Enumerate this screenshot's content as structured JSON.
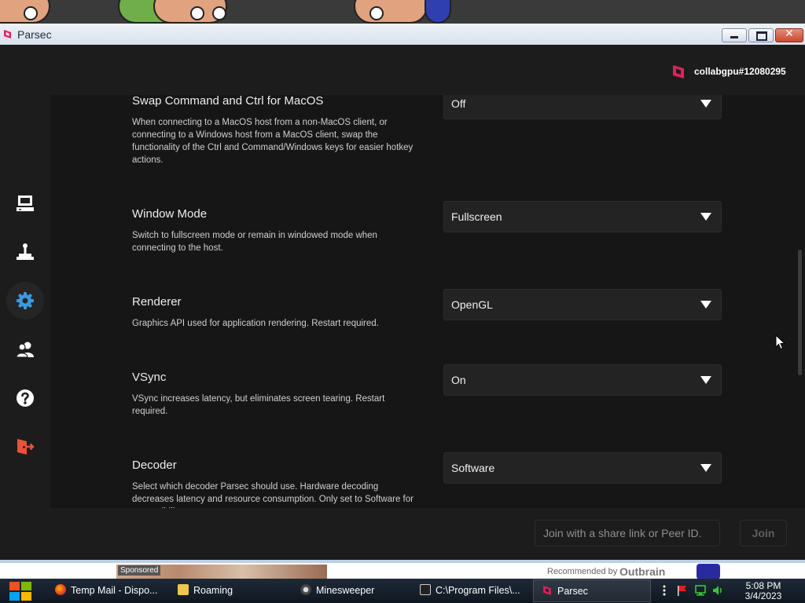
{
  "window": {
    "title": "Parsec"
  },
  "header": {
    "username": "collabgpu#12080295"
  },
  "settings": [
    {
      "title": "Swap Command and Ctrl for MacOS",
      "description": "When connecting to a MacOS host from a non-MacOS client, or connecting to a Windows host from a MacOS client, swap the functionality of the Ctrl and Command/Windows keys for easier hotkey actions.",
      "value": "Off"
    },
    {
      "title": "Window Mode",
      "description": "Switch to fullscreen mode or remain in windowed mode when connecting to the host.",
      "value": "Fullscreen"
    },
    {
      "title": "Renderer",
      "description": "Graphics API used for application rendering. Restart required.",
      "value": "OpenGL"
    },
    {
      "title": "VSync",
      "description": "VSync increases latency, but eliminates screen tearing. Restart required.",
      "value": "On"
    },
    {
      "title": "Decoder",
      "description": "Select which decoder Parsec should use. Hardware decoding decreases latency and resource consumption. Only set to Software for compatibility reasons.",
      "value": "Software"
    }
  ],
  "sidebar": {
    "items": [
      {
        "name": "computers",
        "icon": "computer-icon"
      },
      {
        "name": "arcade",
        "icon": "joystick-icon"
      },
      {
        "name": "settings",
        "icon": "gear-icon",
        "active": true
      },
      {
        "name": "friends",
        "icon": "users-icon"
      },
      {
        "name": "help",
        "icon": "help-icon"
      },
      {
        "name": "logout",
        "icon": "logout-icon"
      }
    ]
  },
  "footer": {
    "join_placeholder": "Join with a share link or Peer ID.",
    "join_label": "Join"
  },
  "ad": {
    "sponsored": "Sponsored",
    "recommended_by": "Recommended by",
    "brand": "Outbrain"
  },
  "taskbar": {
    "tasks": [
      {
        "label": "Temp Mail - Dispo...",
        "icon": "firefox-icon"
      },
      {
        "label": "Roaming",
        "icon": "folder-icon"
      },
      {
        "label": "Minesweeper",
        "icon": "mine-icon"
      },
      {
        "label": "C:\\Program Files\\...",
        "icon": "console-icon"
      },
      {
        "label": "Parsec",
        "icon": "parsec-icon",
        "active": true
      }
    ],
    "time": "5:08 PM",
    "date": "3/4/2023"
  },
  "colors": {
    "accent": "#e0215c",
    "gear_blue": "#3b9ae1",
    "logout_red": "#e5533a",
    "background": "#161616"
  }
}
